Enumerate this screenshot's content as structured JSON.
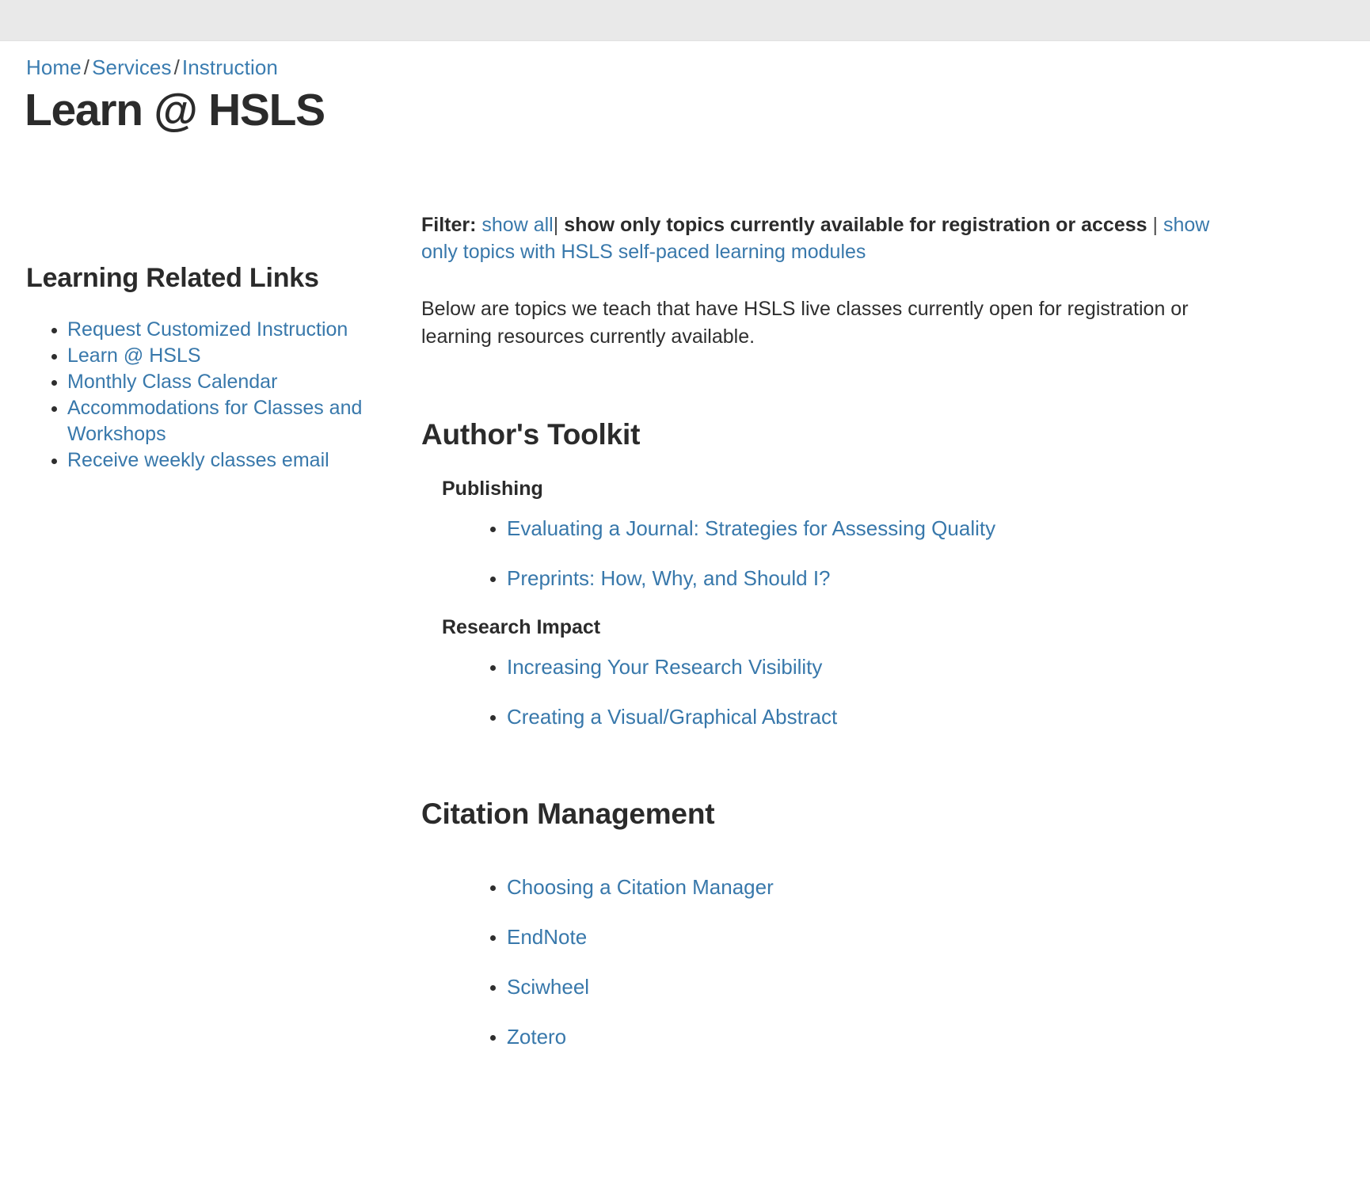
{
  "topbar": {
    "present": true
  },
  "breadcrumb": {
    "items": [
      {
        "label": "Home"
      },
      {
        "label": "Services"
      },
      {
        "label": "Instruction"
      }
    ],
    "separator": "/"
  },
  "page_title": "Learn @ HSLS",
  "sidebar": {
    "heading": "Learning Related Links",
    "items": [
      {
        "label": "Request Customized Instruction"
      },
      {
        "label": "Learn @ HSLS"
      },
      {
        "label": "Monthly Class Calendar"
      },
      {
        "label": "Accommodations for Classes and Workshops"
      },
      {
        "label": "Receive weekly classes email"
      }
    ]
  },
  "filter": {
    "label": "Filter:",
    "show_all": "show all",
    "pipe1": "|",
    "active_option": "show only topics currently available for registration or access",
    "pipe2": "|",
    "modules_option": "show only topics with HSLS self-paced learning modules"
  },
  "intro": "Below are topics we teach that have HSLS live classes currently open for registration or learning resources currently available.",
  "sections": [
    {
      "title": "Author's Toolkit",
      "subsections": [
        {
          "title": "Publishing",
          "links": [
            {
              "label": "Evaluating a Journal: Strategies for Assessing Quality"
            },
            {
              "label": "Preprints: How, Why, and Should I?"
            }
          ]
        },
        {
          "title": "Research Impact",
          "links": [
            {
              "label": "Increasing Your Research Visibility"
            },
            {
              "label": "Creating a Visual/Graphical Abstract"
            }
          ]
        }
      ]
    },
    {
      "title": "Citation Management",
      "subsections": [
        {
          "title": "",
          "links": [
            {
              "label": "Choosing a Citation Manager"
            },
            {
              "label": "EndNote"
            },
            {
              "label": "Sciwheel"
            },
            {
              "label": "Zotero"
            }
          ]
        }
      ]
    }
  ],
  "colors": {
    "link": "#3878ab",
    "text": "#2b2b2b",
    "topbar": "#e9e9e9"
  }
}
